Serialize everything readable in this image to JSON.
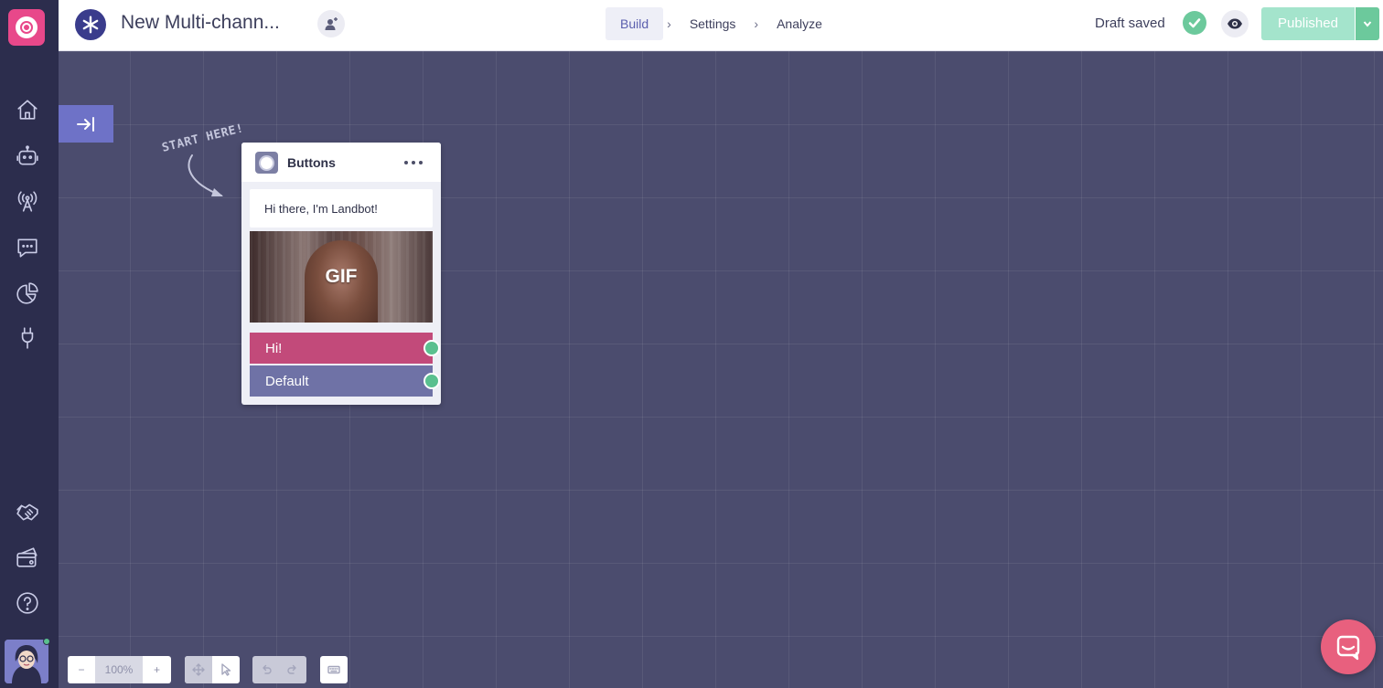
{
  "app": {
    "bot_name": "New Multi-chann...",
    "accent_color": "#e8488a",
    "brand_blue": "#3a3c8c"
  },
  "sidebar": {
    "items": [
      {
        "name": "home-icon"
      },
      {
        "name": "bot-icon"
      },
      {
        "name": "broadcast-icon"
      },
      {
        "name": "chat-icon"
      },
      {
        "name": "analytics-pie-icon"
      },
      {
        "name": "integrations-plug-icon"
      }
    ],
    "bottom_items": [
      {
        "name": "partners-handshake-icon"
      },
      {
        "name": "billing-icon"
      },
      {
        "name": "help-icon"
      }
    ],
    "user_status": "online"
  },
  "header": {
    "steps": [
      {
        "label": "Build",
        "active": true
      },
      {
        "label": "Settings",
        "active": false
      },
      {
        "label": "Analyze",
        "active": false
      }
    ],
    "step_separator": "›",
    "status_text": "Draft saved",
    "publish_label": "Published"
  },
  "canvas": {
    "start_hint": "START HERE!",
    "block": {
      "title": "Buttons",
      "message": "Hi there, I'm Landbot!",
      "media_label": "GIF",
      "buttons": [
        {
          "label": "Hi!",
          "color": "#c24a7a"
        },
        {
          "label": "Default",
          "color": "#6f72a6"
        }
      ],
      "connector_color": "#5ac08f"
    }
  },
  "toolbar": {
    "zoom_out": "−",
    "zoom_value": "100%",
    "zoom_in": "+"
  }
}
